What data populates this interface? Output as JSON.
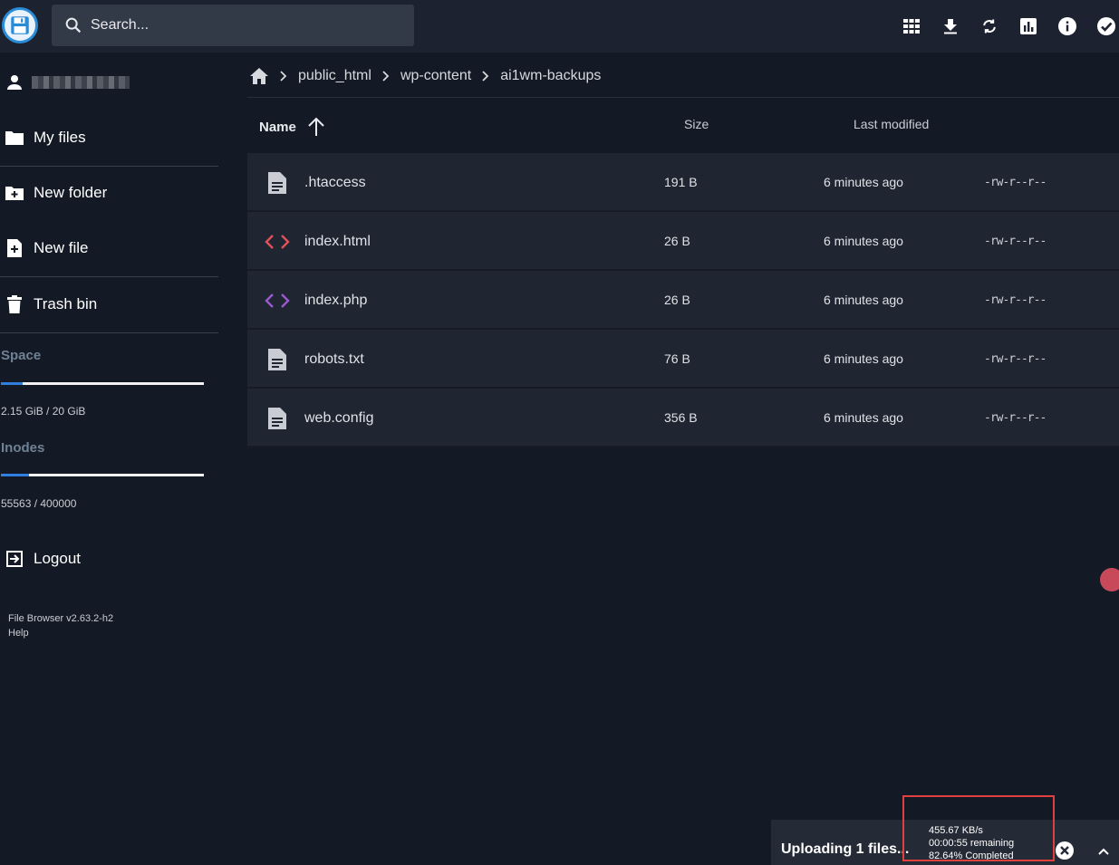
{
  "header": {
    "search_placeholder": "Search...",
    "icons": [
      "grid-view-icon",
      "download-icon",
      "sync-icon",
      "chart-icon",
      "info-icon",
      "select-all-icon"
    ]
  },
  "sidebar": {
    "items": [
      {
        "label": "My files",
        "icon": "folder-icon"
      },
      {
        "label": "New folder",
        "icon": "new-folder-icon"
      },
      {
        "label": "New file",
        "icon": "new-file-icon"
      },
      {
        "label": "Trash bin",
        "icon": "trash-icon"
      }
    ],
    "space": {
      "label": "Space",
      "value": "2.15 GiB / 20 GiB",
      "fraction": 0.1075
    },
    "inodes": {
      "label": "Inodes",
      "value": "55563 / 400000",
      "fraction": 0.139
    },
    "logout_label": "Logout",
    "version": "File Browser v2.63.2-h2",
    "help": "Help"
  },
  "breadcrumb": [
    "public_html",
    "wp-content",
    "ai1wm-backups"
  ],
  "table": {
    "columns": {
      "name": "Name",
      "size": "Size",
      "modified": "Last modified"
    },
    "rows": [
      {
        "name": ".htaccess",
        "size": "191 B",
        "modified": "6 minutes ago",
        "perm": "-rw-r--r--",
        "icon": "document-icon"
      },
      {
        "name": "index.html",
        "size": "26 B",
        "modified": "6 minutes ago",
        "perm": "-rw-r--r--",
        "icon": "code-icon"
      },
      {
        "name": "index.php",
        "size": "26 B",
        "modified": "6 minutes ago",
        "perm": "-rw-r--r--",
        "icon": "code-icon"
      },
      {
        "name": "robots.txt",
        "size": "76 B",
        "modified": "6 minutes ago",
        "perm": "-rw-r--r--",
        "icon": "document-icon"
      },
      {
        "name": "web.config",
        "size": "356 B",
        "modified": "6 minutes ago",
        "perm": "-rw-r--r--",
        "icon": "document-icon"
      }
    ]
  },
  "upload": {
    "title": "Uploading 1 files...",
    "speed": "455.67 KB/s",
    "remaining": "00:00:55 remaining",
    "completed": "82.64% Completed"
  },
  "colors": {
    "accent": "#2f7ee0",
    "highlight": "#e0413f",
    "html_icon": "#e0525a",
    "php_icon": "#9b59d0"
  }
}
